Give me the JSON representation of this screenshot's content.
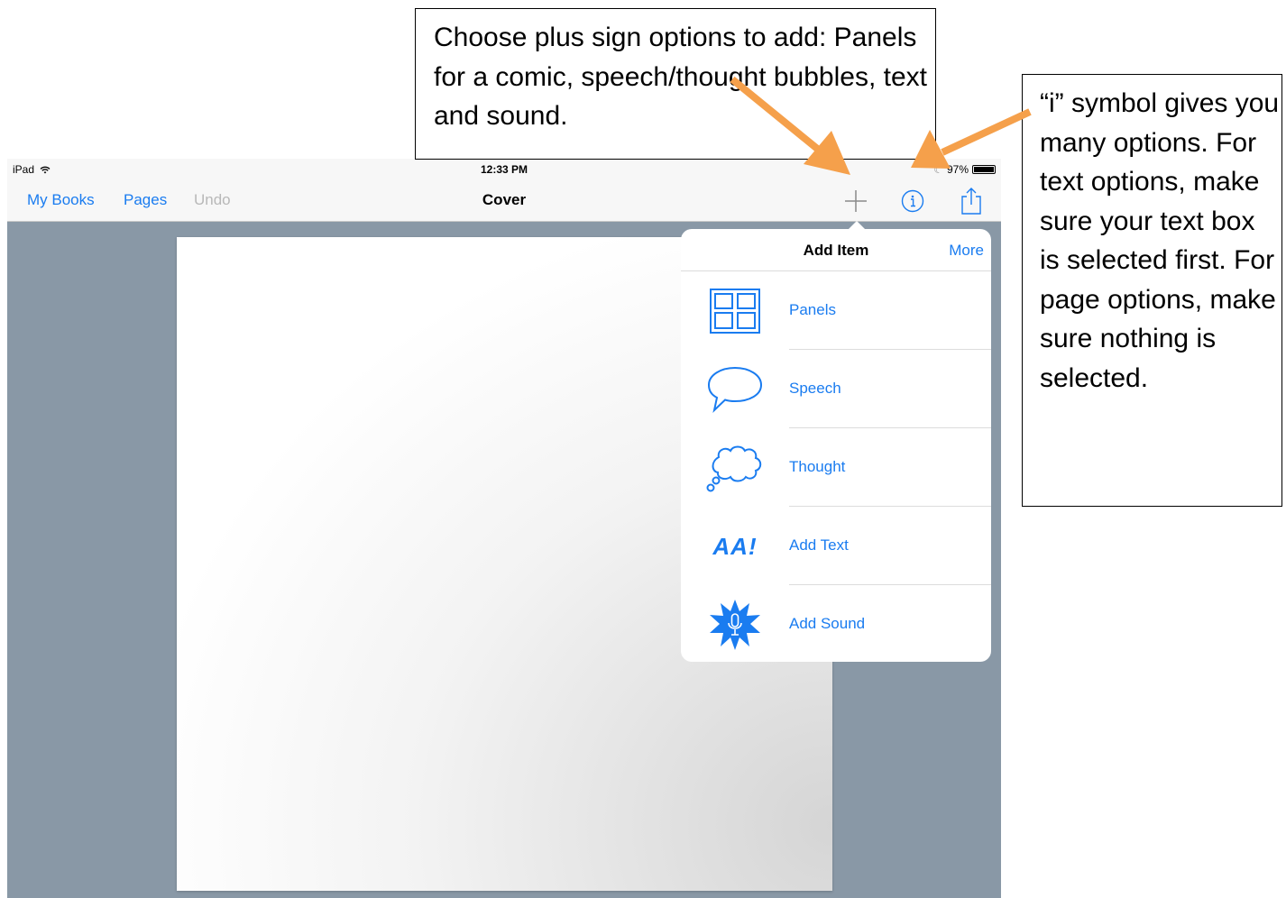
{
  "callouts": {
    "plus_text": "Choose plus sign options to add: Panels for a comic, speech/thought bubbles, text and sound.",
    "info_text": "“i” symbol gives you many options. For text options, make sure your text box is selected first. For page options, make sure nothing is selected."
  },
  "status_bar": {
    "device": "iPad",
    "time": "12:33 PM",
    "battery": "97%"
  },
  "nav": {
    "my_books": "My Books",
    "pages": "Pages",
    "undo": "Undo",
    "title": "Cover",
    "plus_icon": "plus-icon",
    "info_icon": "info-icon",
    "share_icon": "share-icon"
  },
  "popover": {
    "title": "Add Item",
    "more": "More",
    "items": [
      {
        "label": "Panels",
        "icon": "panels-icon"
      },
      {
        "label": "Speech",
        "icon": "speech-bubble-icon"
      },
      {
        "label": "Thought",
        "icon": "thought-bubble-icon"
      },
      {
        "label": "Add Text",
        "icon": "text-icon",
        "icon_text": "AA!"
      },
      {
        "label": "Add Sound",
        "icon": "sound-icon"
      }
    ]
  },
  "colors": {
    "accent": "#1a7cf0",
    "background": "#8998a6",
    "arrow": "#f5a04b"
  }
}
